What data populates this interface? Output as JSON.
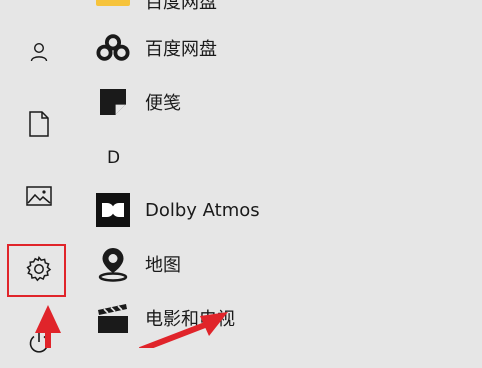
{
  "colors": {
    "background": "#e6e6e6",
    "highlight": "#e0242a",
    "icon_dark": "#1a1a1a",
    "folder": "#f6c33b"
  },
  "sidebar": {
    "items": [
      {
        "icon": "user-icon"
      },
      {
        "icon": "document-icon"
      },
      {
        "icon": "pictures-icon"
      },
      {
        "icon": "gear-icon",
        "highlighted": true
      },
      {
        "icon": "power-icon"
      }
    ]
  },
  "app_list": {
    "partial_top_label": "百度网盘",
    "items": [
      {
        "label": "百度网盘",
        "icon": "baidu-netdisk-icon"
      },
      {
        "label": "便笺",
        "icon": "sticky-notes-icon"
      }
    ],
    "group_header": "D",
    "group_items": [
      {
        "label": "Dolby Atmos",
        "icon": "dolby-icon"
      },
      {
        "label": "地图",
        "icon": "maps-icon"
      },
      {
        "label": "电影和电视",
        "icon": "movies-tv-icon"
      }
    ]
  },
  "annotations": {
    "arrows": [
      {
        "name": "arrow-to-settings"
      },
      {
        "name": "arrow-to-movies"
      }
    ]
  }
}
